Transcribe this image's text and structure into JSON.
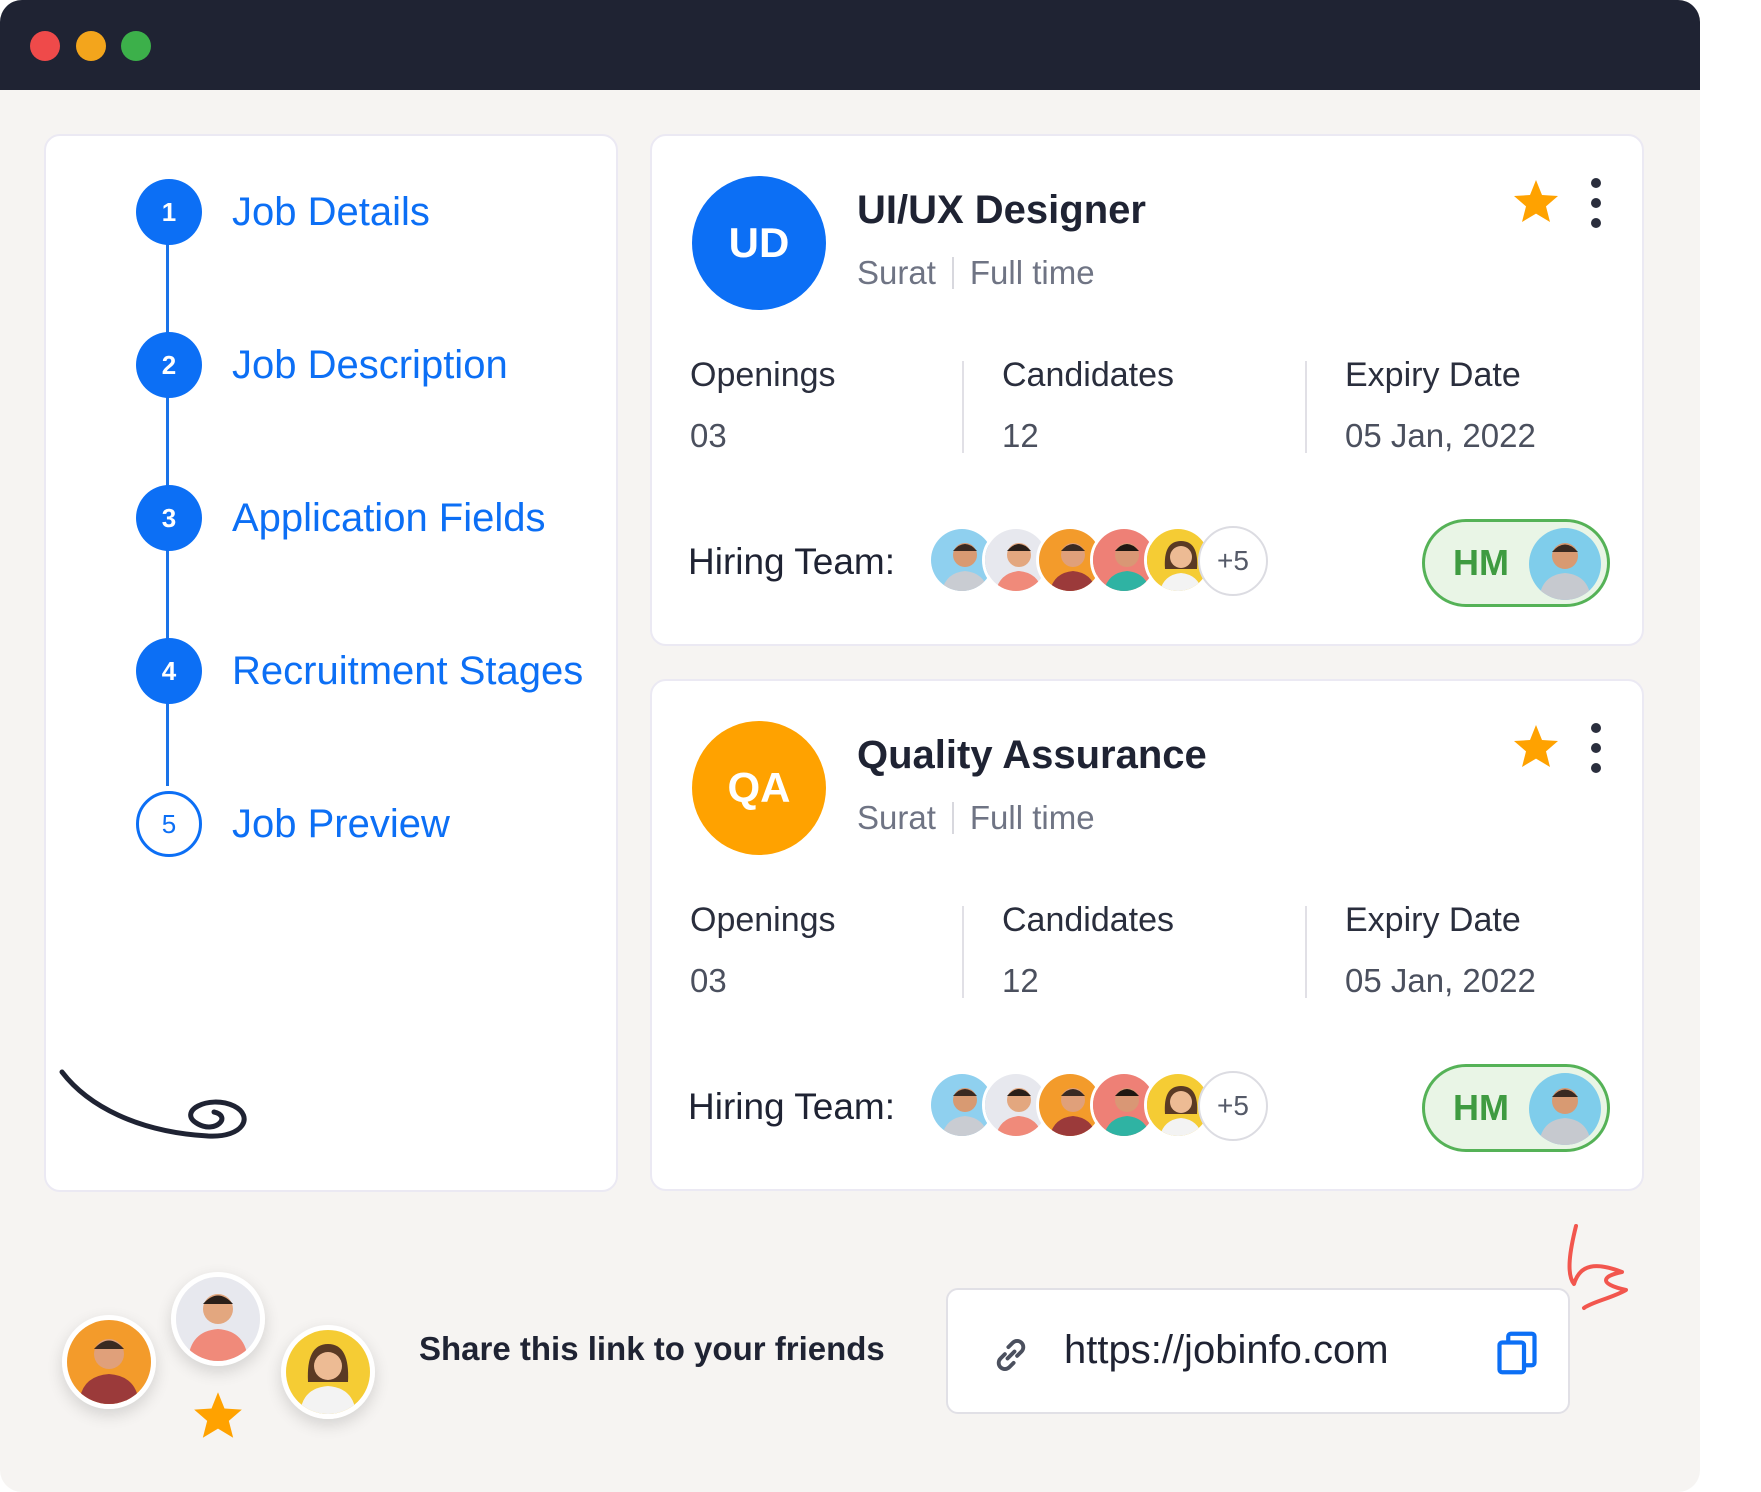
{
  "window": {
    "controls": [
      "close",
      "minimize",
      "maximize"
    ]
  },
  "steps": [
    {
      "number": "1",
      "label": "Job Details",
      "state": "done"
    },
    {
      "number": "2",
      "label": "Job Description",
      "state": "done"
    },
    {
      "number": "3",
      "label": "Application Fields",
      "state": "done"
    },
    {
      "number": "4",
      "label": "Recruitment Stages",
      "state": "done"
    },
    {
      "number": "5",
      "label": "Job Preview",
      "state": "current"
    }
  ],
  "jobs": [
    {
      "initials": "UD",
      "avatar_color": "#0c6ff5",
      "title": "UI/UX Designer",
      "location": "Surat",
      "type": "Full time",
      "openings_label": "Openings",
      "openings": "03",
      "candidates_label": "Candidates",
      "candidates": "12",
      "expiry_label": "Expiry Date",
      "expiry": "05 Jan, 2022",
      "hiring_label": "Hiring Team:",
      "team_more": "+5",
      "hm_label": "HM"
    },
    {
      "initials": "QA",
      "avatar_color": "#ffa200",
      "title": "Quality Assurance",
      "location": "Surat",
      "type": "Full time",
      "openings_label": "Openings",
      "openings": "03",
      "candidates_label": "Candidates",
      "candidates": "12",
      "expiry_label": "Expiry Date",
      "expiry": "05 Jan, 2022",
      "hiring_label": "Hiring Team:",
      "team_more": "+5",
      "hm_label": "HM"
    }
  ],
  "share": {
    "text": "Share this link to your friends",
    "url": "https://jobinfo.com"
  },
  "colors": {
    "accent": "#0c6ff5",
    "star": "#ffa200",
    "hm_green": "#55b257",
    "titlebar": "#1f2333"
  }
}
